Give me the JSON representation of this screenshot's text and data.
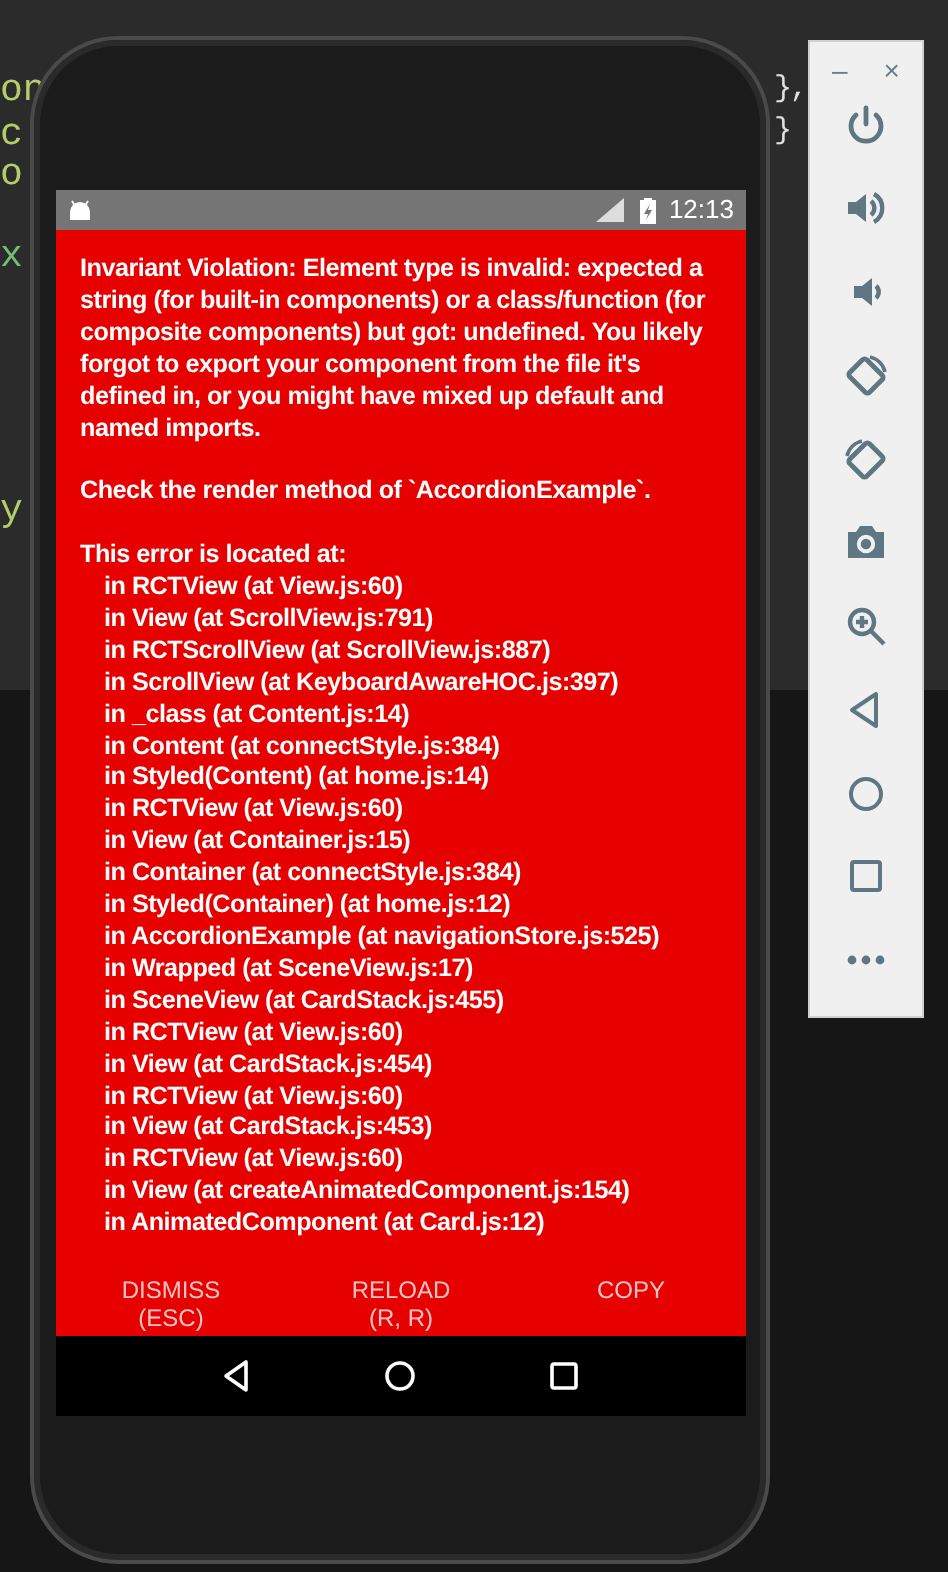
{
  "editor": {
    "left_fragments": [
      {
        "text": "on",
        "color": "#b5cc6a"
      },
      {
        "text": "c",
        "color": "#b5cc6a"
      },
      {
        "text": "o",
        "color": "#b5cc6a"
      },
      {
        "text": "x",
        "color": "#6fbf73"
      },
      {
        "text": "y",
        "color": "#b5cc6a"
      }
    ],
    "right_fragments": [
      "},",
      "}"
    ]
  },
  "phone": {
    "status_bar": {
      "time": "12:13"
    },
    "error": {
      "message": "Invariant Violation: Element type is invalid: expected a string (for built-in components) or a class/function (for composite components) but got: undefined. You likely forgot to export your component from the file it's defined in, or you might have mixed up default and named imports.",
      "hint": "Check the render method of `AccordionExample`.",
      "location_title": "This error is located at:",
      "stack": [
        "in RCTView (at View.js:60)",
        "in View (at ScrollView.js:791)",
        "in RCTScrollView (at ScrollView.js:887)",
        "in ScrollView (at KeyboardAwareHOC.js:397)",
        "in _class (at Content.js:14)",
        "in Content (at connectStyle.js:384)",
        "in Styled(Content) (at home.js:14)",
        "in RCTView (at View.js:60)",
        "in View (at Container.js:15)",
        "in Container (at connectStyle.js:384)",
        "in Styled(Container) (at home.js:12)",
        "in AccordionExample (at navigationStore.js:525)",
        "in Wrapped (at SceneView.js:17)",
        "in SceneView (at CardStack.js:455)",
        "in RCTView (at View.js:60)",
        "in View (at CardStack.js:454)",
        "in RCTView (at View.js:60)",
        "in View (at CardStack.js:453)",
        "in RCTView (at View.js:60)",
        "in View (at createAnimatedComponent.js:154)",
        "in AnimatedComponent (at Card.js:12)"
      ]
    },
    "buttons": [
      {
        "label": "DISMISS",
        "shortcut": "(ESC)"
      },
      {
        "label": "RELOAD",
        "shortcut": "(R, R)"
      },
      {
        "label": "COPY"
      }
    ]
  },
  "emulator_toolbar": {
    "window_buttons": [
      "–",
      "×"
    ],
    "tools": [
      {
        "kind": "power"
      },
      {
        "kind": "volume-up"
      },
      {
        "kind": "volume-down"
      },
      {
        "kind": "rotate-left"
      },
      {
        "kind": "rotate-right"
      },
      {
        "kind": "screenshot"
      },
      {
        "kind": "zoom"
      },
      {
        "kind": "back"
      },
      {
        "kind": "home"
      },
      {
        "kind": "overview"
      },
      {
        "kind": "more"
      }
    ]
  }
}
